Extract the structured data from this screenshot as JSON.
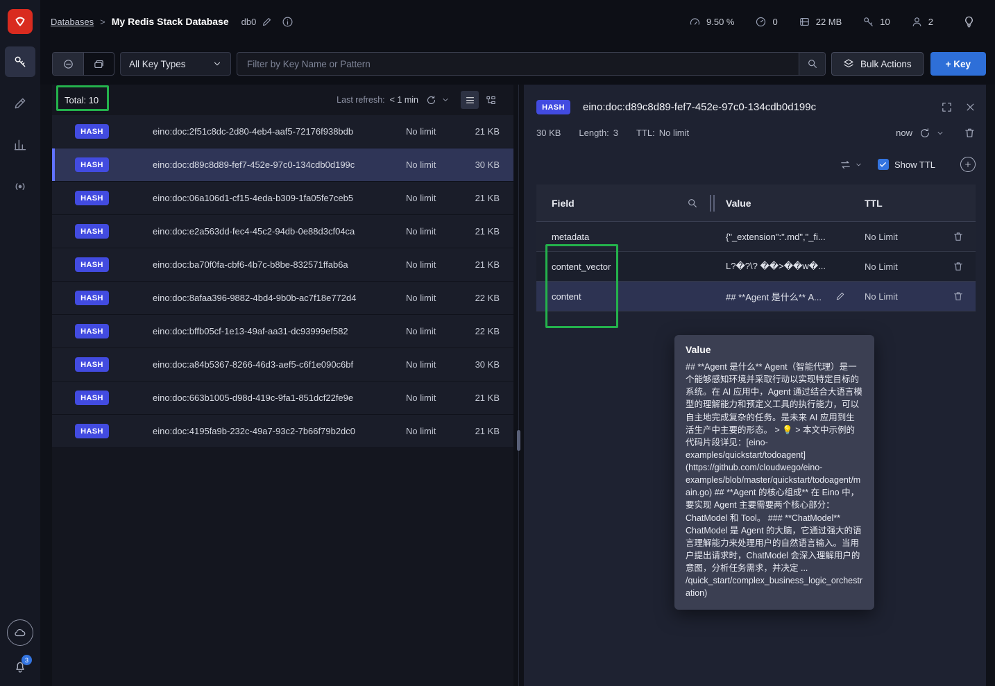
{
  "header": {
    "breadcrumb_link": "Databases",
    "breadcrumb_separator": ">",
    "db_title": "My Redis Stack Database",
    "db_index": "db0",
    "metrics": {
      "cpu_percent": "9.50 %",
      "commands_per_sec": "0",
      "memory": "22 MB",
      "total_keys": "10",
      "connected_clients": "2"
    }
  },
  "sidebar": {
    "notification_count": "3"
  },
  "filter_bar": {
    "key_type_selected": "All Key Types",
    "search_placeholder": "Filter by Key Name or Pattern",
    "bulk_actions": "Bulk Actions",
    "add_key": "+ Key"
  },
  "key_list": {
    "total": "Total: 10",
    "last_refresh_label": "Last refresh:",
    "last_refresh_value": "< 1 min",
    "rows": [
      {
        "type": "HASH",
        "name": "eino:doc:2f51c8dc-2d80-4eb4-aaf5-72176f938bdb",
        "ttl": "No limit",
        "size": "21 KB"
      },
      {
        "type": "HASH",
        "name": "eino:doc:d89c8d89-fef7-452e-97c0-134cdb0d199c",
        "ttl": "No limit",
        "size": "30 KB"
      },
      {
        "type": "HASH",
        "name": "eino:doc:06a106d1-cf15-4eda-b309-1fa05fe7ceb5",
        "ttl": "No limit",
        "size": "21 KB"
      },
      {
        "type": "HASH",
        "name": "eino:doc:e2a563dd-fec4-45c2-94db-0e88d3cf04ca",
        "ttl": "No limit",
        "size": "21 KB"
      },
      {
        "type": "HASH",
        "name": "eino:doc:ba70f0fa-cbf6-4b7c-b8be-832571ffab6a",
        "ttl": "No limit",
        "size": "21 KB"
      },
      {
        "type": "HASH",
        "name": "eino:doc:8afaa396-9882-4bd4-9b0b-ac7f18e772d4",
        "ttl": "No limit",
        "size": "22 KB"
      },
      {
        "type": "HASH",
        "name": "eino:doc:bffb05cf-1e13-49af-aa31-dc93999ef582",
        "ttl": "No limit",
        "size": "22 KB"
      },
      {
        "type": "HASH",
        "name": "eino:doc:a84b5367-8266-46d3-aef5-c6f1e090c6bf",
        "ttl": "No limit",
        "size": "30 KB"
      },
      {
        "type": "HASH",
        "name": "eino:doc:663b1005-d98d-419c-9fa1-851dcf22fe9e",
        "ttl": "No limit",
        "size": "21 KB"
      },
      {
        "type": "HASH",
        "name": "eino:doc:4195fa9b-232c-49a7-93c2-7b66f79b2dc0",
        "ttl": "No limit",
        "size": "21 KB"
      }
    ]
  },
  "details": {
    "type_badge": "HASH",
    "key_name": "eino:doc:d89c8d89-fef7-452e-97c0-134cdb0d199c",
    "size": "30 KB",
    "length_label": "Length:",
    "length_value": "3",
    "ttl_label": "TTL:",
    "ttl_value": "No limit",
    "refresh_value": "now",
    "show_ttl_label": "Show TTL",
    "table": {
      "header_field": "Field",
      "header_value": "Value",
      "header_ttl": "TTL",
      "rows": [
        {
          "field": "metadata",
          "value": "{\"_extension\":\".md\",\"_fi...",
          "ttl": "No Limit"
        },
        {
          "field": "content_vector",
          "value": "L?�?\\? ��>��w�...",
          "ttl": "No Limit"
        },
        {
          "field": "content",
          "value": "## **Agent 是什么** A...",
          "ttl": "No Limit"
        }
      ]
    },
    "tooltip": {
      "title": "Value",
      "body": "## **Agent 是什么** Agent（智能代理）是一个能够感知环境并采取行动以实现特定目标的系统。在 AI 应用中，Agent 通过结合大语言模型的理解能力和预定义工具的执行能力，可以自主地完成复杂的任务。是未来 AI 应用到生活生产中主要的形态。 > 💡 > 本文中示例的代码片段详见：[eino-examples/quickstart/todoagent](https://github.com/cloudwego/eino-examples/blob/master/quickstart/todoagent/main.go) ## **Agent 的核心组成** 在 Eino 中，要实现 Agent 主要需要两个核心部分：ChatModel 和 Tool。 ### **ChatModel** ChatModel 是 Agent 的大脑，它通过强大的语言理解能力来处理用户的自然语言输入。当用户提出请求时，ChatModel 会深入理解用户的意图，分析任务需求，并决定 ... /quick_start/complex_business_logic_orchestration)"
    }
  },
  "icons": {
    "logo": "redis-logo",
    "nav": [
      "browser-key-icon",
      "workbench-icon",
      "analytics-icon",
      "pubsub-icon",
      "cloud-icon",
      "notifications-bell-icon"
    ],
    "metrics": [
      "cpu-gauge-icon",
      "ops-gauge-icon",
      "memory-db-icon",
      "keys-key-icon",
      "clients-user-icon",
      "lightbulb-icon"
    ]
  }
}
